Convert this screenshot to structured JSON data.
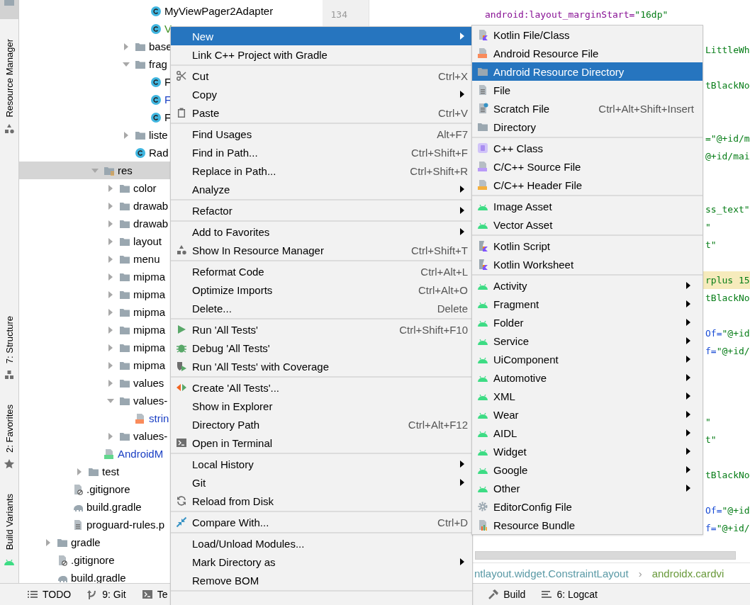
{
  "tool_strip": [
    {
      "label": "Resource Manager"
    },
    {
      "label": "7: Structure"
    },
    {
      "label": "2: Favorites"
    },
    {
      "label": "Build Variants"
    }
  ],
  "project_tree": [
    {
      "children": [
        {
          "children": [
            {
              "children": [
                {
                  "children": [
                    {
                      "children": [
                        {
                          "children": [
                            {
                              "label": "MyViewPager2Adapter",
                              "kind": "class",
                              "color": "#000000",
                              "selected": false
                            },
                            {
                              "label": "V",
                              "kind": "class",
                              "color": "#3d8f1f",
                              "selected": false
                            }
                          ]
                        },
                        {
                          "label": "base",
                          "kind": "folder",
                          "expanded": false,
                          "color": "#000000",
                          "selected": false
                        },
                        {
                          "label": "frag",
                          "kind": "folder",
                          "expanded": true,
                          "color": "#000000",
                          "selected": false,
                          "children": [
                            {
                              "label": "F",
                              "kind": "class",
                              "color": "#000000",
                              "selected": false
                            },
                            {
                              "label": "F",
                              "kind": "class",
                              "color": "#1a3fc4",
                              "selected": false
                            },
                            {
                              "label": "F",
                              "kind": "class",
                              "color": "#000000",
                              "selected": false
                            }
                          ]
                        },
                        {
                          "label": "liste",
                          "kind": "folder",
                          "expanded": false,
                          "color": "#000000",
                          "selected": false
                        },
                        {
                          "label": "Rad",
                          "kind": "class",
                          "color": "#000000",
                          "selected": false
                        }
                      ]
                    }
                  ]
                },
                {
                  "label": "res",
                  "kind": "resfolder",
                  "expanded": true,
                  "color": "#000000",
                  "selected": true,
                  "children": [
                    {
                      "label": "color",
                      "kind": "folder",
                      "expanded": false,
                      "color": "#000000",
                      "selected": false
                    },
                    {
                      "label": "drawab",
                      "kind": "folder",
                      "expanded": false,
                      "color": "#000000",
                      "selected": false
                    },
                    {
                      "label": "drawab",
                      "kind": "folder",
                      "expanded": false,
                      "color": "#000000",
                      "selected": false
                    },
                    {
                      "label": "layout",
                      "kind": "folder",
                      "expanded": false,
                      "color": "#000000",
                      "selected": false
                    },
                    {
                      "label": "menu",
                      "kind": "folder",
                      "expanded": false,
                      "color": "#000000",
                      "selected": false
                    },
                    {
                      "label": "mipma",
                      "kind": "folder",
                      "expanded": false,
                      "color": "#000000",
                      "selected": false
                    },
                    {
                      "label": "mipma",
                      "kind": "folder",
                      "expanded": false,
                      "color": "#000000",
                      "selected": false
                    },
                    {
                      "label": "mipma",
                      "kind": "folder",
                      "expanded": false,
                      "color": "#000000",
                      "selected": false
                    },
                    {
                      "label": "mipma",
                      "kind": "folder",
                      "expanded": false,
                      "color": "#000000",
                      "selected": false
                    },
                    {
                      "label": "mipma",
                      "kind": "folder",
                      "expanded": false,
                      "color": "#000000",
                      "selected": false
                    },
                    {
                      "label": "mipma",
                      "kind": "folder",
                      "expanded": false,
                      "color": "#000000",
                      "selected": false
                    },
                    {
                      "label": "values",
                      "kind": "folder",
                      "expanded": false,
                      "color": "#000000",
                      "selected": false
                    },
                    {
                      "label": "values-",
                      "kind": "folder",
                      "expanded": true,
                      "color": "#000000",
                      "selected": false,
                      "children": [
                        {
                          "label": "strin",
                          "kind": "xml",
                          "color": "#1a3fc4",
                          "selected": false
                        }
                      ]
                    },
                    {
                      "label": "values-",
                      "kind": "folder",
                      "expanded": false,
                      "color": "#000000",
                      "selected": false
                    }
                  ]
                },
                {
                  "label": "AndroidM",
                  "kind": "manifest",
                  "color": "#1a3fc4",
                  "selected": false
                }
              ]
            },
            {
              "label": "test",
              "kind": "folder",
              "expanded": false,
              "color": "#000000",
              "selected": false
            }
          ]
        },
        {
          "label": ".gitignore",
          "kind": "gitignore",
          "color": "#000000",
          "selected": false
        },
        {
          "label": "build.gradle",
          "kind": "gradle",
          "color": "#000000",
          "selected": false
        },
        {
          "label": "proguard-rules.p",
          "kind": "text",
          "color": "#000000",
          "selected": false
        }
      ]
    },
    {
      "label": "gradle",
      "kind": "folder",
      "expanded": false,
      "color": "#000000",
      "selected": false
    },
    {
      "label": ".gitignore",
      "kind": "gitignore",
      "color": "#000000",
      "selected": false
    },
    {
      "label": "build.gradle",
      "kind": "gradle",
      "color": "#000000",
      "selected": false
    }
  ],
  "editor": {
    "line_number": "134",
    "lines": [
      {
        "kind": "line",
        "highlighted": false,
        "segments": [
          {
            "kind": "ns",
            "text": "android:layout_marginStart="
          },
          {
            "kind": "value",
            "text": "\"16dp\""
          }
        ]
      },
      {
        "kind": "blank"
      },
      {
        "kind": "fragment",
        "highlighted": false,
        "segments": [
          {
            "kind": "value",
            "text": "LittleWh"
          }
        ]
      },
      {
        "kind": "blank"
      },
      {
        "kind": "fragment",
        "highlighted": false,
        "segments": [
          {
            "kind": "value",
            "text": "tBlackNo"
          }
        ]
      },
      {
        "kind": "blank"
      },
      {
        "kind": "blank"
      },
      {
        "kind": "fragment",
        "highlighted": false,
        "segments": [
          {
            "kind": "value",
            "text": "=\"@+id/m"
          }
        ]
      },
      {
        "kind": "fragment",
        "highlighted": false,
        "segments": [
          {
            "kind": "value",
            "text": "@+id/mai"
          }
        ]
      },
      {
        "kind": "blank"
      },
      {
        "kind": "blank"
      },
      {
        "kind": "fragment",
        "highlighted": false,
        "segments": [
          {
            "kind": "value",
            "text": "ss_text\""
          }
        ]
      },
      {
        "kind": "fragment",
        "highlighted": false,
        "segments": [
          {
            "kind": "value",
            "text": "\""
          }
        ]
      },
      {
        "kind": "fragment",
        "highlighted": false,
        "segments": [
          {
            "kind": "value",
            "text": "t\""
          }
        ]
      },
      {
        "kind": "blank"
      },
      {
        "kind": "fragment",
        "highlighted": true,
        "segments": [
          {
            "kind": "value",
            "text": "rplus 15"
          }
        ]
      },
      {
        "kind": "fragment",
        "highlighted": false,
        "segments": [
          {
            "kind": "value",
            "text": "tBlackNo"
          }
        ]
      },
      {
        "kind": "blank"
      },
      {
        "kind": "fragment",
        "highlighted": false,
        "segments": [
          {
            "kind": "attr",
            "text": "Of="
          },
          {
            "kind": "value",
            "text": "\"@+id"
          }
        ]
      },
      {
        "kind": "fragment",
        "highlighted": false,
        "segments": [
          {
            "kind": "attr",
            "text": "f="
          },
          {
            "kind": "value",
            "text": "\"@+id/"
          }
        ]
      },
      {
        "kind": "blank"
      },
      {
        "kind": "blank"
      },
      {
        "kind": "blank"
      },
      {
        "kind": "fragment",
        "highlighted": false,
        "segments": [
          {
            "kind": "value",
            "text": "\""
          }
        ]
      },
      {
        "kind": "fragment",
        "highlighted": false,
        "segments": [
          {
            "kind": "value",
            "text": "t\""
          }
        ]
      },
      {
        "kind": "blank"
      },
      {
        "kind": "fragment",
        "highlighted": false,
        "segments": [
          {
            "kind": "value",
            "text": "tBlackNo"
          }
        ]
      },
      {
        "kind": "blank"
      },
      {
        "kind": "fragment",
        "highlighted": false,
        "segments": [
          {
            "kind": "attr",
            "text": "Of="
          },
          {
            "kind": "value",
            "text": "\"@+id"
          }
        ]
      },
      {
        "kind": "fragment",
        "highlighted": false,
        "segments": [
          {
            "kind": "attr",
            "text": "f="
          },
          {
            "kind": "value",
            "text": "\"@+id/"
          }
        ]
      }
    ],
    "breadcrumbs": [
      "ntlayout.widget.ConstraintLayout",
      "androidx.cardvi"
    ],
    "breadcrumb_separator": "›"
  },
  "bottom_bar": [
    {
      "label": "TODO"
    },
    {
      "label": "9: Git"
    },
    {
      "label": "Te"
    },
    {
      "label": "Build"
    },
    {
      "label": "6: Logcat"
    }
  ],
  "context_menu": [
    {
      "kind": "item",
      "label": "New",
      "submenu": true,
      "selected": true
    },
    {
      "kind": "item",
      "label": "Link C++ Project with Gradle",
      "submenu": false,
      "selected": false
    },
    {
      "kind": "separator"
    },
    {
      "kind": "item",
      "label": "Cut",
      "shortcut": "Ctrl+X",
      "submenu": false,
      "selected": false
    },
    {
      "kind": "item",
      "label": "Copy",
      "submenu": true,
      "selected": false
    },
    {
      "kind": "item",
      "label": "Paste",
      "shortcut": "Ctrl+V",
      "submenu": false,
      "selected": false
    },
    {
      "kind": "separator"
    },
    {
      "kind": "item",
      "label": "Find Usages",
      "shortcut": "Alt+F7",
      "submenu": false,
      "selected": false
    },
    {
      "kind": "item",
      "label": "Find in Path...",
      "shortcut": "Ctrl+Shift+F",
      "submenu": false,
      "selected": false
    },
    {
      "kind": "item",
      "label": "Replace in Path...",
      "shortcut": "Ctrl+Shift+R",
      "submenu": false,
      "selected": false
    },
    {
      "kind": "item",
      "label": "Analyze",
      "submenu": true,
      "selected": false
    },
    {
      "kind": "separator"
    },
    {
      "kind": "item",
      "label": "Refactor",
      "submenu": true,
      "selected": false
    },
    {
      "kind": "separator"
    },
    {
      "kind": "item",
      "label": "Add to Favorites",
      "submenu": true,
      "selected": false
    },
    {
      "kind": "item",
      "label": "Show In Resource Manager",
      "shortcut": "Ctrl+Shift+T",
      "submenu": false,
      "selected": false
    },
    {
      "kind": "separator"
    },
    {
      "kind": "item",
      "label": "Reformat Code",
      "shortcut": "Ctrl+Alt+L",
      "submenu": false,
      "selected": false
    },
    {
      "kind": "item",
      "label": "Optimize Imports",
      "shortcut": "Ctrl+Alt+O",
      "submenu": false,
      "selected": false
    },
    {
      "kind": "item",
      "label": "Delete...",
      "shortcut": "Delete",
      "submenu": false,
      "selected": false
    },
    {
      "kind": "separator"
    },
    {
      "kind": "item",
      "label": "Run 'All Tests'",
      "shortcut": "Ctrl+Shift+F10",
      "submenu": false,
      "selected": false
    },
    {
      "kind": "item",
      "label": "Debug 'All Tests'",
      "submenu": false,
      "selected": false
    },
    {
      "kind": "item",
      "label": "Run 'All Tests' with Coverage",
      "submenu": false,
      "selected": false
    },
    {
      "kind": "separator"
    },
    {
      "kind": "item",
      "label": "Create 'All Tests'...",
      "submenu": false,
      "selected": false
    },
    {
      "kind": "item",
      "label": "Show in Explorer",
      "submenu": false,
      "selected": false
    },
    {
      "kind": "item",
      "label": "Directory Path",
      "shortcut": "Ctrl+Alt+F12",
      "submenu": false,
      "selected": false
    },
    {
      "kind": "item",
      "label": "Open in Terminal",
      "submenu": false,
      "selected": false
    },
    {
      "kind": "separator"
    },
    {
      "kind": "item",
      "label": "Local History",
      "submenu": true,
      "selected": false
    },
    {
      "kind": "item",
      "label": "Git",
      "submenu": true,
      "selected": false
    },
    {
      "kind": "item",
      "label": "Reload from Disk",
      "submenu": false,
      "selected": false
    },
    {
      "kind": "separator"
    },
    {
      "kind": "item",
      "label": "Compare With...",
      "shortcut": "Ctrl+D",
      "submenu": false,
      "selected": false
    },
    {
      "kind": "separator"
    },
    {
      "kind": "item",
      "label": "Load/Unload Modules...",
      "submenu": false,
      "selected": false
    },
    {
      "kind": "item",
      "label": "Mark Directory as",
      "submenu": true,
      "selected": false
    },
    {
      "kind": "item",
      "label": "Remove BOM",
      "submenu": false,
      "selected": false
    },
    {
      "kind": "separator"
    }
  ],
  "new_submenu": [
    {
      "kind": "item",
      "label": "Kotlin File/Class",
      "submenu": false,
      "selected": false
    },
    {
      "kind": "item",
      "label": "Android Resource File",
      "submenu": false,
      "selected": false
    },
    {
      "kind": "item",
      "label": "Android Resource Directory",
      "submenu": false,
      "selected": true
    },
    {
      "kind": "item",
      "label": "File",
      "submenu": false,
      "selected": false
    },
    {
      "kind": "item",
      "label": "Scratch File",
      "shortcut": "Ctrl+Alt+Shift+Insert",
      "submenu": false,
      "selected": false
    },
    {
      "kind": "item",
      "label": "Directory",
      "submenu": false,
      "selected": false
    },
    {
      "kind": "separator"
    },
    {
      "kind": "item",
      "label": "C++ Class",
      "submenu": false,
      "selected": false
    },
    {
      "kind": "item",
      "label": "C/C++ Source File",
      "submenu": false,
      "selected": false
    },
    {
      "kind": "item",
      "label": "C/C++ Header File",
      "submenu": false,
      "selected": false
    },
    {
      "kind": "separator"
    },
    {
      "kind": "item",
      "label": "Image Asset",
      "submenu": false,
      "selected": false
    },
    {
      "kind": "item",
      "label": "Vector Asset",
      "submenu": false,
      "selected": false
    },
    {
      "kind": "separator"
    },
    {
      "kind": "item",
      "label": "Kotlin Script",
      "submenu": false,
      "selected": false
    },
    {
      "kind": "item",
      "label": "Kotlin Worksheet",
      "submenu": false,
      "selected": false
    },
    {
      "kind": "separator"
    },
    {
      "kind": "item",
      "label": "Activity",
      "submenu": true,
      "selected": false
    },
    {
      "kind": "item",
      "label": "Fragment",
      "submenu": true,
      "selected": false
    },
    {
      "kind": "item",
      "label": "Folder",
      "submenu": true,
      "selected": false
    },
    {
      "kind": "item",
      "label": "Service",
      "submenu": true,
      "selected": false
    },
    {
      "kind": "item",
      "label": "UiComponent",
      "submenu": true,
      "selected": false
    },
    {
      "kind": "item",
      "label": "Automotive",
      "submenu": true,
      "selected": false
    },
    {
      "kind": "item",
      "label": "XML",
      "submenu": true,
      "selected": false
    },
    {
      "kind": "item",
      "label": "Wear",
      "submenu": true,
      "selected": false
    },
    {
      "kind": "item",
      "label": "AIDL",
      "submenu": true,
      "selected": false
    },
    {
      "kind": "item",
      "label": "Widget",
      "submenu": true,
      "selected": false
    },
    {
      "kind": "item",
      "label": "Google",
      "submenu": true,
      "selected": false
    },
    {
      "kind": "item",
      "label": "Other",
      "submenu": true,
      "selected": false
    },
    {
      "kind": "item",
      "label": "EditorConfig File",
      "submenu": false,
      "selected": false
    },
    {
      "kind": "item",
      "label": "Resource Bundle",
      "submenu": false,
      "selected": false
    }
  ]
}
